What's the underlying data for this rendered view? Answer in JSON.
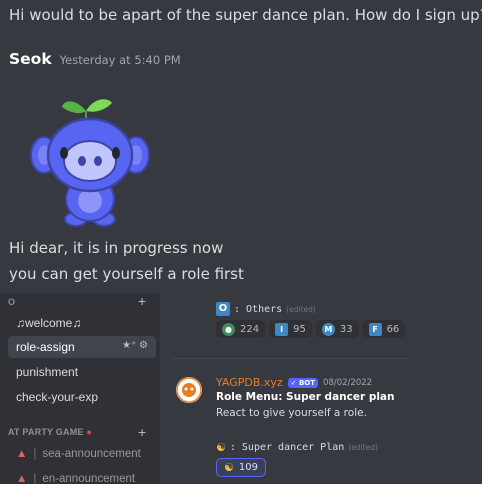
{
  "messages": {
    "line1": "Hi would to be apart of the super dance plan. How do I sign up?",
    "author": "Seok",
    "timestamp": "Yesterday at 5:40 PM",
    "line2": "Hi dear, it is in progress now",
    "line3": "you can get yourself a role first"
  },
  "screenshot": {
    "sidebar": {
      "category_top": "O",
      "channels": [
        {
          "label": "♫welcome♫"
        },
        {
          "label": "role-assign",
          "selected": true
        },
        {
          "label": "punishment"
        },
        {
          "label": "check-your-exp"
        }
      ],
      "category2": "AT PARTY GAME",
      "announcements": [
        "sea-announcement",
        "en-announcement"
      ]
    },
    "role_block": {
      "letter": "O",
      "others_label": ": Others",
      "edited": "(edited)",
      "reactions": [
        {
          "icon": "globe-icon",
          "count": "224"
        },
        {
          "icon": "I-icon",
          "count": "95"
        },
        {
          "icon": "M-icon",
          "count": "33"
        },
        {
          "icon": "F-icon",
          "count": "66"
        }
      ]
    },
    "bot_message": {
      "name": "YAGPDB.xyz",
      "tag": "✓ BOT",
      "date": "08/02/2022",
      "title": "Role Menu: Super dancer plan",
      "desc": "React to give yourself a role.",
      "plan_label": ": Super dancer Plan",
      "edited": "(edited)",
      "plan_count": "109"
    }
  },
  "colors": {
    "background": "#36393f",
    "sidebar": "#2f3136",
    "blurple": "#5865f2",
    "bot_name": "#e67e22",
    "role_blue": "#3b88c3"
  }
}
